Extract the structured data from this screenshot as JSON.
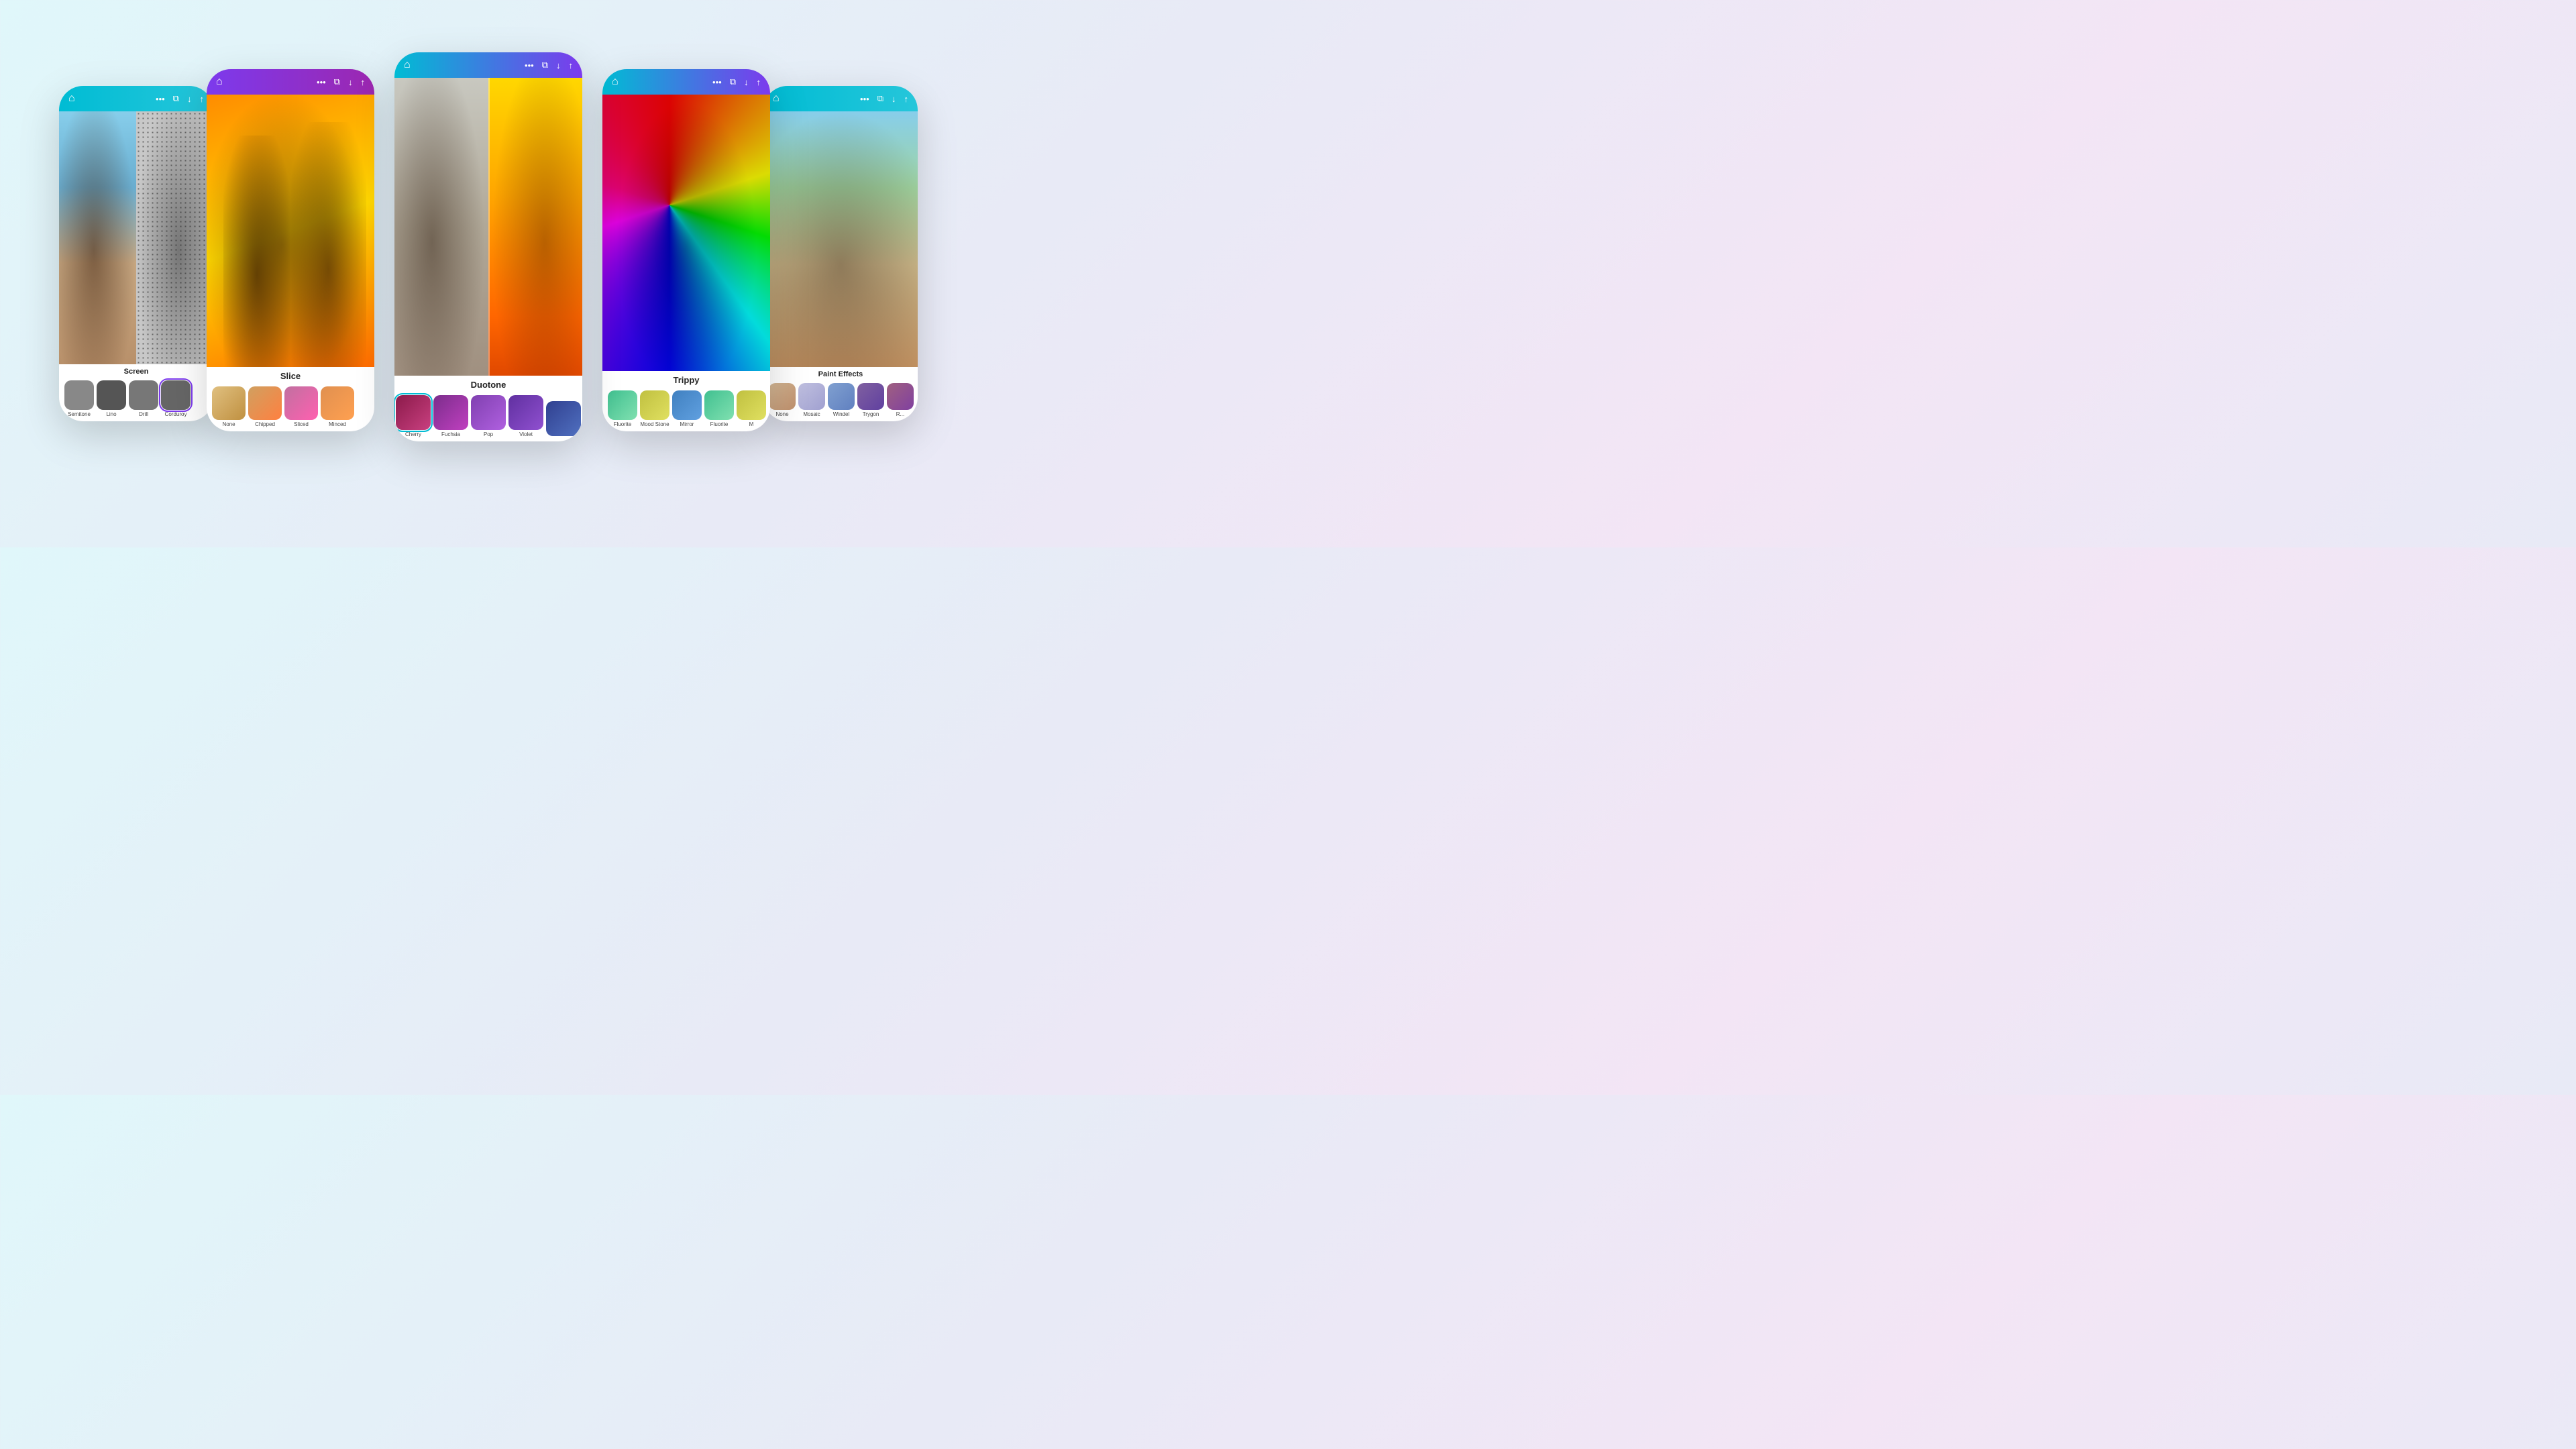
{
  "background": {
    "gradient_start": "#e0f7fa",
    "gradient_end": "#f3e5f5"
  },
  "phones": [
    {
      "id": "far-left",
      "position": "far-left",
      "toolbar_style": "teal",
      "effect_name": "Screen",
      "thumbnails": [
        {
          "label": "Semitone",
          "selected": false
        },
        {
          "label": "Lino",
          "selected": false
        },
        {
          "label": "Drill",
          "selected": false
        },
        {
          "label": "Corduroy",
          "selected": true
        }
      ]
    },
    {
      "id": "second-left",
      "position": "second-left",
      "toolbar_style": "purple",
      "effect_name": "Slice",
      "thumbnails": [
        {
          "label": "None",
          "selected": false
        },
        {
          "label": "Chipped",
          "selected": false
        },
        {
          "label": "Sliced",
          "selected": false
        },
        {
          "label": "Minced",
          "selected": false
        }
      ]
    },
    {
      "id": "center",
      "position": "center",
      "toolbar_style": "cyan-purple",
      "effect_name": "Duotone",
      "thumbnails": [
        {
          "label": "Cherry",
          "selected": true
        },
        {
          "label": "Fuchsia",
          "selected": false
        },
        {
          "label": "Pop",
          "selected": false
        },
        {
          "label": "Violet",
          "selected": false
        },
        {
          "label": "",
          "selected": false
        }
      ]
    },
    {
      "id": "second-right",
      "position": "second-right",
      "toolbar_style": "cyan-purple",
      "effect_name": "Trippy",
      "thumbnails": [
        {
          "label": "Fluorite",
          "selected": false
        },
        {
          "label": "Mood Stone",
          "selected": false
        },
        {
          "label": "Mirror",
          "selected": false
        },
        {
          "label": "Fluorite",
          "selected": false
        },
        {
          "label": "M",
          "selected": false
        }
      ]
    },
    {
      "id": "far-right",
      "position": "far-right",
      "toolbar_style": "teal",
      "effect_name": "Paint Effects",
      "thumbnails": [
        {
          "label": "None",
          "selected": false
        },
        {
          "label": "Mosaic",
          "selected": false
        },
        {
          "label": "Windel",
          "selected": false
        },
        {
          "label": "Trygon",
          "selected": false
        },
        {
          "label": "R...",
          "selected": false
        }
      ]
    }
  ],
  "icons": {
    "home": "⌂",
    "more": "···",
    "copy": "⧉",
    "download": "↓",
    "share": "↑"
  }
}
